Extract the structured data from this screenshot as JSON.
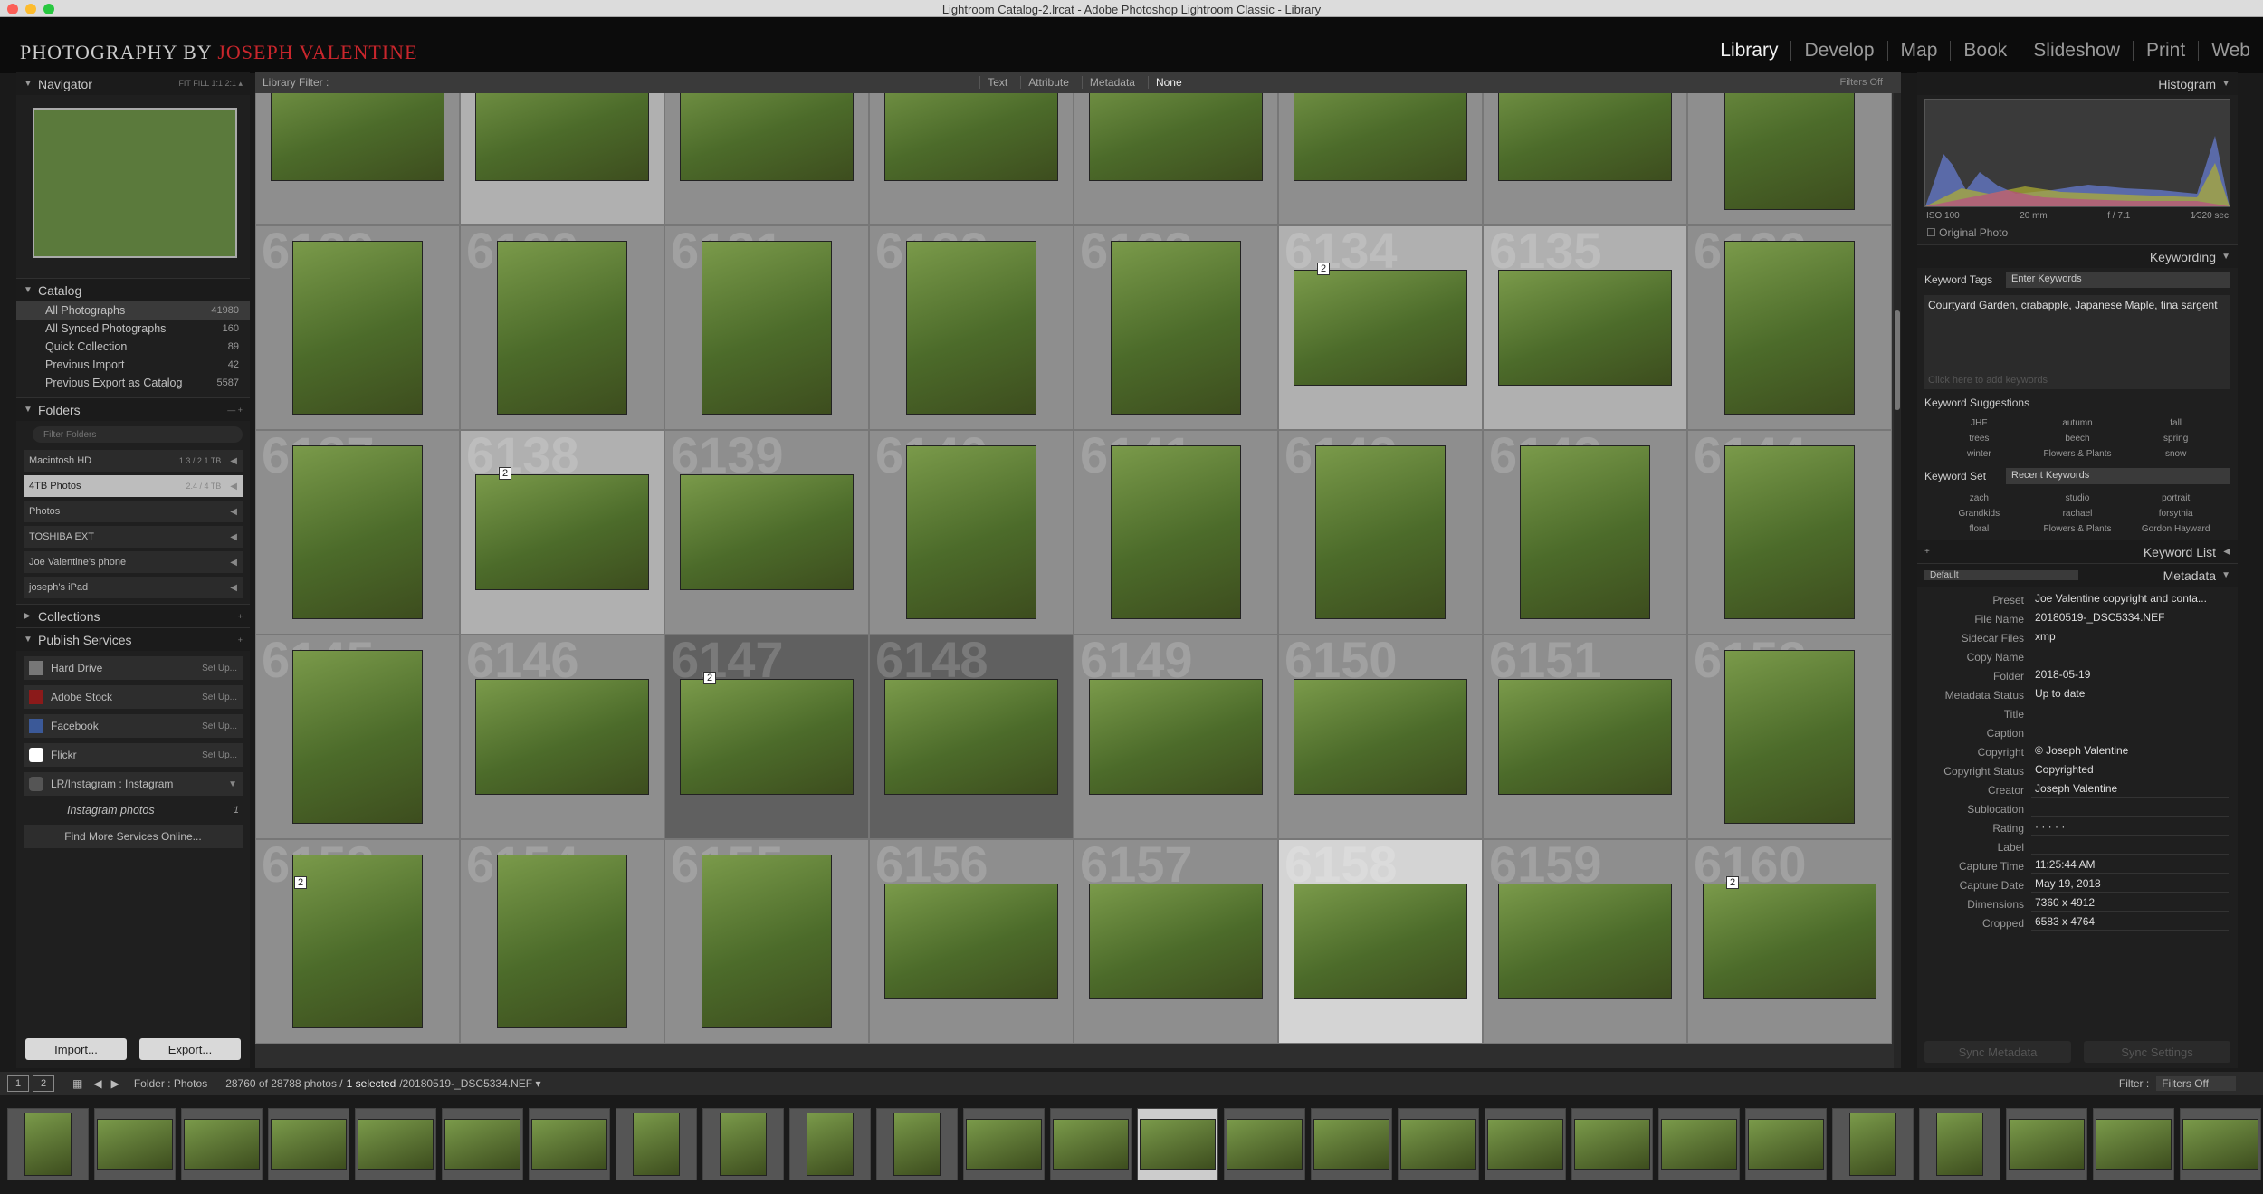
{
  "window": {
    "title": "Lightroom Catalog-2.lrcat - Adobe Photoshop Lightroom Classic - Library"
  },
  "identity": {
    "prefix": "PHOTOGRAPHY BY ",
    "name": "JOSEPH VALENTINE"
  },
  "modules": [
    "Library",
    "Develop",
    "Map",
    "Book",
    "Slideshow",
    "Print",
    "Web"
  ],
  "left_panel": {
    "navigator": {
      "title": "Navigator",
      "zoom_options": "FIT  FILL  1:1  2:1 ▴"
    },
    "catalog": {
      "title": "Catalog",
      "items": [
        {
          "label": "All Photographs",
          "count": "41980"
        },
        {
          "label": "All Synced Photographs",
          "count": "160"
        },
        {
          "label": "Quick Collection",
          "count": "89"
        },
        {
          "label": "Previous Import",
          "count": "42"
        },
        {
          "label": "Previous Export as Catalog",
          "count": "5587"
        }
      ]
    },
    "folders": {
      "title": "Folders",
      "filter_placeholder": "Filter Folders",
      "volumes": [
        {
          "label": "Macintosh HD",
          "size": "1.3 / 2.1 TB"
        },
        {
          "label": "4TB Photos",
          "size": "2.4 / 4 TB"
        },
        {
          "label": "Photos",
          "size": ""
        },
        {
          "label": "TOSHIBA EXT",
          "size": ""
        },
        {
          "label": "Joe Valentine's phone",
          "size": ""
        },
        {
          "label": "joseph's iPad",
          "size": ""
        }
      ]
    },
    "collections": {
      "title": "Collections"
    },
    "publish": {
      "title": "Publish Services",
      "services": [
        {
          "label": "Hard Drive",
          "action": "Set Up..."
        },
        {
          "label": "Adobe Stock",
          "action": "Set Up..."
        },
        {
          "label": "Facebook",
          "action": "Set Up..."
        },
        {
          "label": "Flickr",
          "action": "Set Up..."
        },
        {
          "label": "LR/Instagram : Instagram",
          "action": ""
        }
      ],
      "sub": {
        "label": "Instagram photos",
        "count": "1"
      },
      "find_more": "Find More Services Online..."
    },
    "buttons": {
      "import": "Import...",
      "export": "Export..."
    }
  },
  "filter_bar": {
    "label": "Library Filter :",
    "options": [
      "Text",
      "Attribute",
      "Metadata",
      "None"
    ],
    "filters_off": "Filters Off"
  },
  "grid": {
    "rows": [
      [
        {
          "num": "",
          "o": "land"
        },
        {
          "num": "",
          "o": "land"
        },
        {
          "num": "",
          "o": "land"
        },
        {
          "num": "",
          "o": "land"
        },
        {
          "num": "",
          "o": "land"
        },
        {
          "num": "",
          "o": "land"
        },
        {
          "num": "",
          "o": "land"
        },
        {
          "num": "",
          "o": "port"
        }
      ],
      [
        {
          "num": "6129",
          "o": "port"
        },
        {
          "num": "6130",
          "o": "port"
        },
        {
          "num": "6131",
          "o": "port"
        },
        {
          "num": "6132",
          "o": "port"
        },
        {
          "num": "6133",
          "o": "port"
        },
        {
          "num": "6134",
          "o": "land",
          "stack": "2"
        },
        {
          "num": "6135",
          "o": "land"
        },
        {
          "num": "6136",
          "o": "port"
        }
      ],
      [
        {
          "num": "6137",
          "o": "port"
        },
        {
          "num": "6138",
          "o": "land",
          "stack": "2"
        },
        {
          "num": "6139",
          "o": "land"
        },
        {
          "num": "6140",
          "o": "port"
        },
        {
          "num": "6141",
          "o": "port"
        },
        {
          "num": "6142",
          "o": "port"
        },
        {
          "num": "6143",
          "o": "port"
        },
        {
          "num": "6144",
          "o": "port"
        }
      ],
      [
        {
          "num": "6145",
          "o": "port"
        },
        {
          "num": "6146",
          "o": "land"
        },
        {
          "num": "6147",
          "o": "land",
          "stack": "2"
        },
        {
          "num": "6148",
          "o": "land"
        },
        {
          "num": "6149",
          "o": "land"
        },
        {
          "num": "6150",
          "o": "land"
        },
        {
          "num": "6151",
          "o": "land"
        },
        {
          "num": "6152",
          "o": "port"
        }
      ],
      [
        {
          "num": "6153",
          "o": "port",
          "stack": "2"
        },
        {
          "num": "6154",
          "o": "port"
        },
        {
          "num": "6155",
          "o": "port"
        },
        {
          "num": "6156",
          "o": "land"
        },
        {
          "num": "6157",
          "o": "land"
        },
        {
          "num": "6158",
          "o": "land"
        },
        {
          "num": "6159",
          "o": "land"
        },
        {
          "num": "6160",
          "o": "land",
          "stack": "2"
        }
      ]
    ]
  },
  "right_panel": {
    "histogram": {
      "title": "Histogram",
      "iso": "ISO 100",
      "focal": "20 mm",
      "aperture": "f / 7.1",
      "shutter": "1⁄320 sec",
      "original": "Original Photo"
    },
    "keywording": {
      "title": "Keywording",
      "tags_label": "Keyword Tags",
      "tags_mode": "Enter Keywords",
      "keywords": "Courtyard Garden, crabapple, Japanese Maple, tina sargent",
      "hint": "Click here to add keywords",
      "suggestions_title": "Keyword Suggestions",
      "suggestions": [
        "JHF",
        "autumn",
        "fall",
        "trees",
        "beech",
        "spring",
        "winter",
        "Flowers & Plants",
        "snow"
      ],
      "set_label": "Keyword Set",
      "set_value": "Recent Keywords",
      "set_items": [
        "zach",
        "studio",
        "portrait",
        "Grandkids",
        "rachael",
        "forsythia",
        "floral",
        "Flowers & Plants",
        "Gordon Hayward"
      ]
    },
    "keyword_list": {
      "title": "Keyword List"
    },
    "metadata": {
      "title": "Metadata",
      "preset_default": "Default",
      "fields": [
        {
          "k": "Preset",
          "v": "Joe Valentine copyright and conta..."
        },
        {
          "k": "File Name",
          "v": "20180519-_DSC5334.NEF"
        },
        {
          "k": "Sidecar Files",
          "v": "xmp"
        },
        {
          "k": "Copy Name",
          "v": ""
        },
        {
          "k": "Folder",
          "v": "2018-05-19"
        },
        {
          "k": "Metadata Status",
          "v": "Up to date"
        },
        {
          "k": "Title",
          "v": ""
        },
        {
          "k": "Caption",
          "v": ""
        },
        {
          "k": "Copyright",
          "v": "© Joseph Valentine"
        },
        {
          "k": "Copyright Status",
          "v": "Copyrighted"
        },
        {
          "k": "Creator",
          "v": "Joseph Valentine"
        },
        {
          "k": "Sublocation",
          "v": ""
        },
        {
          "k": "Rating",
          "v": "· · · · ·"
        },
        {
          "k": "Label",
          "v": ""
        },
        {
          "k": "Capture Time",
          "v": "11:25:44 AM"
        },
        {
          "k": "Capture Date",
          "v": "May 19, 2018"
        },
        {
          "k": "Dimensions",
          "v": "7360 x 4912"
        },
        {
          "k": "Cropped",
          "v": "6583 x 4764"
        }
      ]
    },
    "buttons": {
      "sync_metadata": "Sync Metadata",
      "sync_settings": "Sync Settings"
    }
  },
  "filmstrip_bar": {
    "page1": "1",
    "page2": "2",
    "source": "Folder : Photos",
    "count": "28760 of 28788 photos /",
    "selected": "1 selected",
    "file": "/20180519-_DSC5334.NEF ▾",
    "filter_label": "Filter :",
    "filter_value": "Filters Off"
  },
  "filmstrip": {
    "thumbs": 26,
    "current_index": 13
  }
}
